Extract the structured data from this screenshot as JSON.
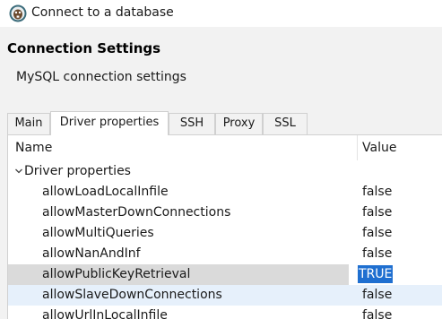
{
  "window": {
    "title": "Connect to a database",
    "icon": "dbeaver-icon"
  },
  "header": {
    "title": "Connection Settings",
    "subtitle": "MySQL connection settings"
  },
  "tabs": [
    {
      "label": "Main",
      "active": false
    },
    {
      "label": "Driver properties",
      "active": true
    },
    {
      "label": "SSH",
      "active": false
    },
    {
      "label": "Proxy",
      "active": false
    },
    {
      "label": "SSL",
      "active": false
    }
  ],
  "table": {
    "columns": {
      "name": "Name",
      "value": "Value"
    },
    "group": {
      "label": "Driver properties",
      "expanded": true,
      "icon": "chevron-down-icon"
    },
    "rows": [
      {
        "name": "allowLoadLocalInfile",
        "value": "false"
      },
      {
        "name": "allowMasterDownConnections",
        "value": "false"
      },
      {
        "name": "allowMultiQueries",
        "value": "false"
      },
      {
        "name": "allowNanAndInf",
        "value": "false"
      },
      {
        "name": "allowPublicKeyRetrieval",
        "value": "TRUE",
        "selected": true
      },
      {
        "name": "allowSlaveDownConnections",
        "value": "false",
        "hover": true
      },
      {
        "name": "allowUrlInLocalInfile",
        "value": "false"
      }
    ]
  },
  "colors": {
    "selection": "#1f6fd0",
    "row_selected": "#dadada",
    "row_hover": "#e6f0fb",
    "header_bg": "#f2f2f2"
  }
}
